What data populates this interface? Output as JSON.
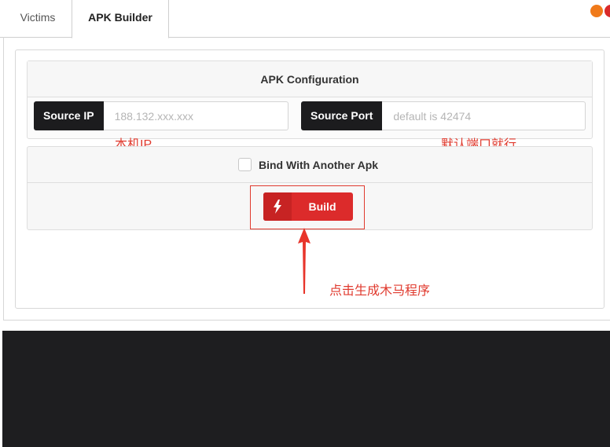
{
  "tabs": [
    {
      "label": "Victims",
      "active": false
    },
    {
      "label": "APK Builder",
      "active": true
    }
  ],
  "config": {
    "heading": "APK Configuration",
    "source_ip": {
      "label": "Source IP",
      "value": "",
      "placeholder": "188.132.xxx.xxx"
    },
    "source_port": {
      "label": "Source Port",
      "value": "",
      "placeholder": "default is 42474"
    }
  },
  "bind": {
    "label": "Bind With Another Apk",
    "checked": false
  },
  "build": {
    "label": "Build",
    "icon": "lightning-bolt-icon"
  },
  "annotations": {
    "ip_note": "本机IP",
    "port_note": "默认端口就行",
    "build_note": "点击生成木马程序"
  },
  "colors": {
    "accent_red": "#dc2b2b",
    "annotation_red": "#e03a2e",
    "dark_label": "#1c1c1e",
    "dot_orange": "#f07a1a",
    "dot_red": "#d92a2a"
  }
}
